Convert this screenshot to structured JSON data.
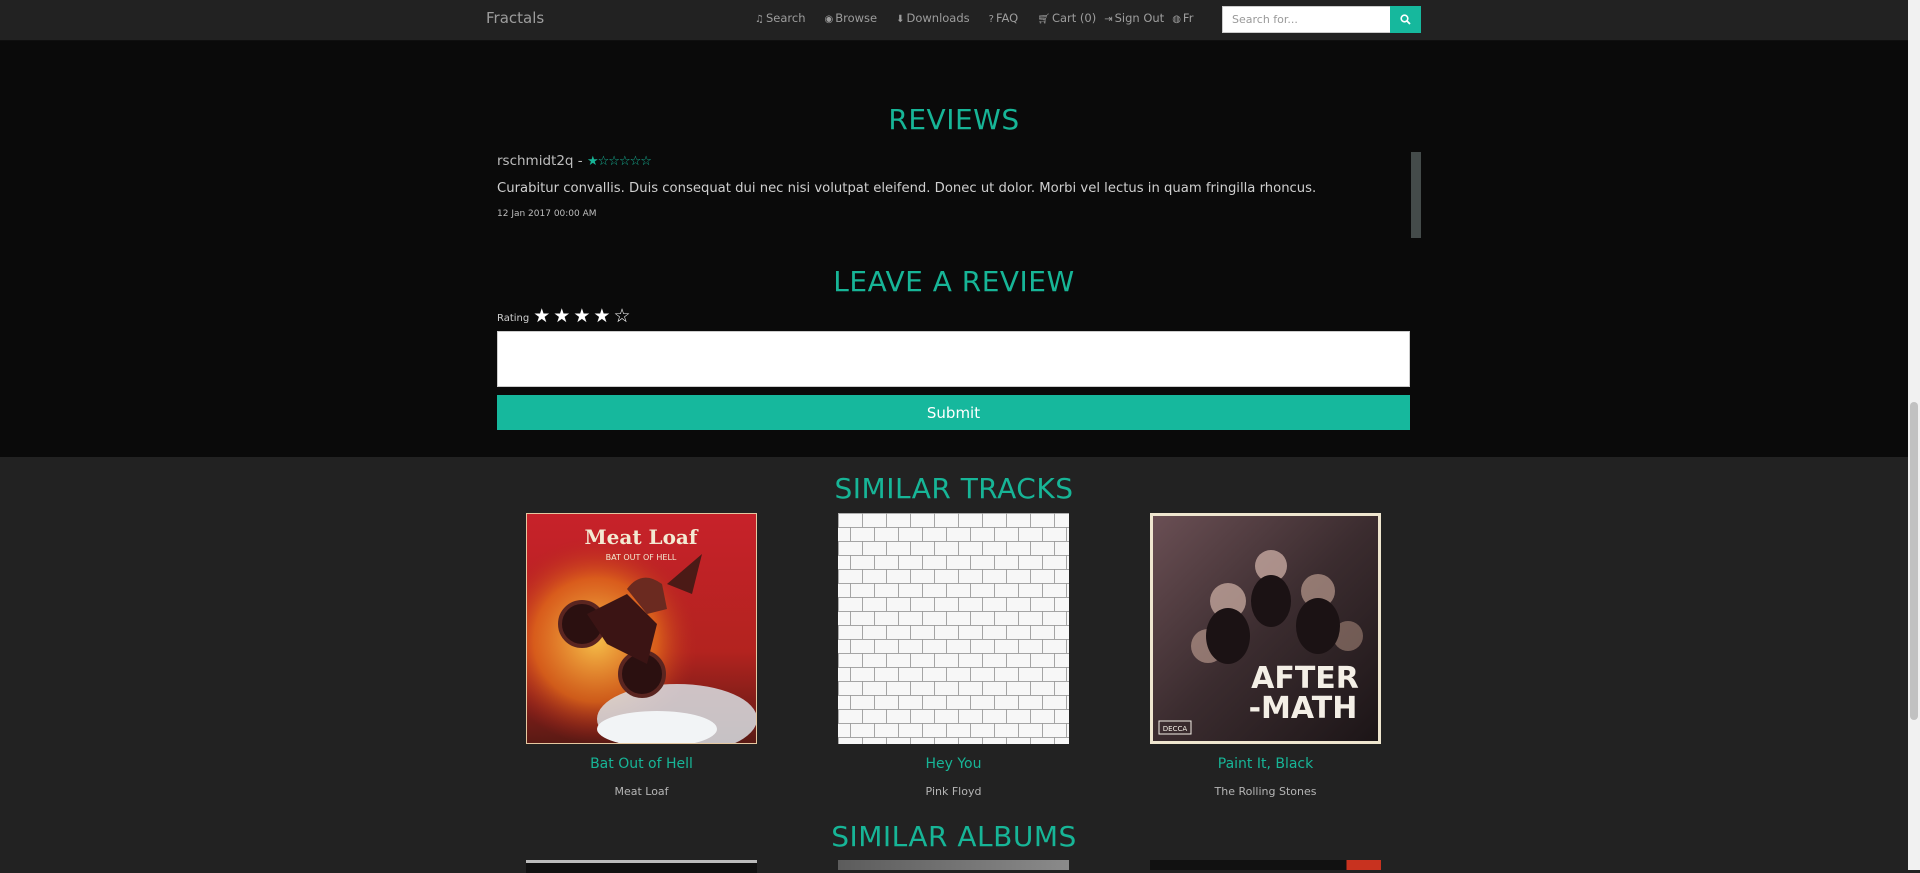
{
  "navbar": {
    "brand": "Fractals",
    "items": [
      {
        "icon": "music-icon",
        "label": "Search"
      },
      {
        "icon": "eye-icon",
        "label": "Browse"
      },
      {
        "icon": "download-icon",
        "label": "Downloads"
      },
      {
        "icon": "question-circle-icon",
        "label": "FAQ"
      },
      {
        "icon": "cart-icon",
        "label": "Cart (0)"
      },
      {
        "icon": "sign-out-icon",
        "label": "Sign Out"
      },
      {
        "icon": "globe-icon",
        "label": "Fr"
      }
    ],
    "search_placeholder": "Search for...",
    "search_icon": "search-icon"
  },
  "reviews": {
    "title": "REVIEWS",
    "items": [
      {
        "user": "rschmidt2q",
        "separator": "-",
        "rating": 1,
        "max_rating": 6,
        "text": "Curabitur convallis. Duis consequat dui nec nisi volutpat eleifend. Donec ut dolor. Morbi vel lectus in quam fringilla rhoncus.",
        "date": "12 Jan 2017 00:00 AM"
      }
    ]
  },
  "leave_review": {
    "title": "LEAVE A REVIEW",
    "rating_label": "Rating",
    "rating_value": 4,
    "rating_max": 5,
    "comment_value": "",
    "submit_label": "Submit"
  },
  "similar_tracks": {
    "title": "SIMILAR TRACKS",
    "items": [
      {
        "title": "Bat Out of Hell",
        "artist": "Meat Loaf",
        "cover_text": "Meat Loaf",
        "cover_subtext": "BAT OUT OF HELL"
      },
      {
        "title": "Hey You",
        "artist": "Pink Floyd"
      },
      {
        "title": "Paint It, Black",
        "artist": "The Rolling Stones",
        "cover_text": "AFTER-MATH",
        "cover_label": "DECCA"
      }
    ]
  },
  "similar_albums": {
    "title": "SIMILAR ALBUMS"
  },
  "colors": {
    "accent": "#16b89d",
    "navbar_bg": "#222222",
    "review_band_bg": "#0a0a0a"
  }
}
